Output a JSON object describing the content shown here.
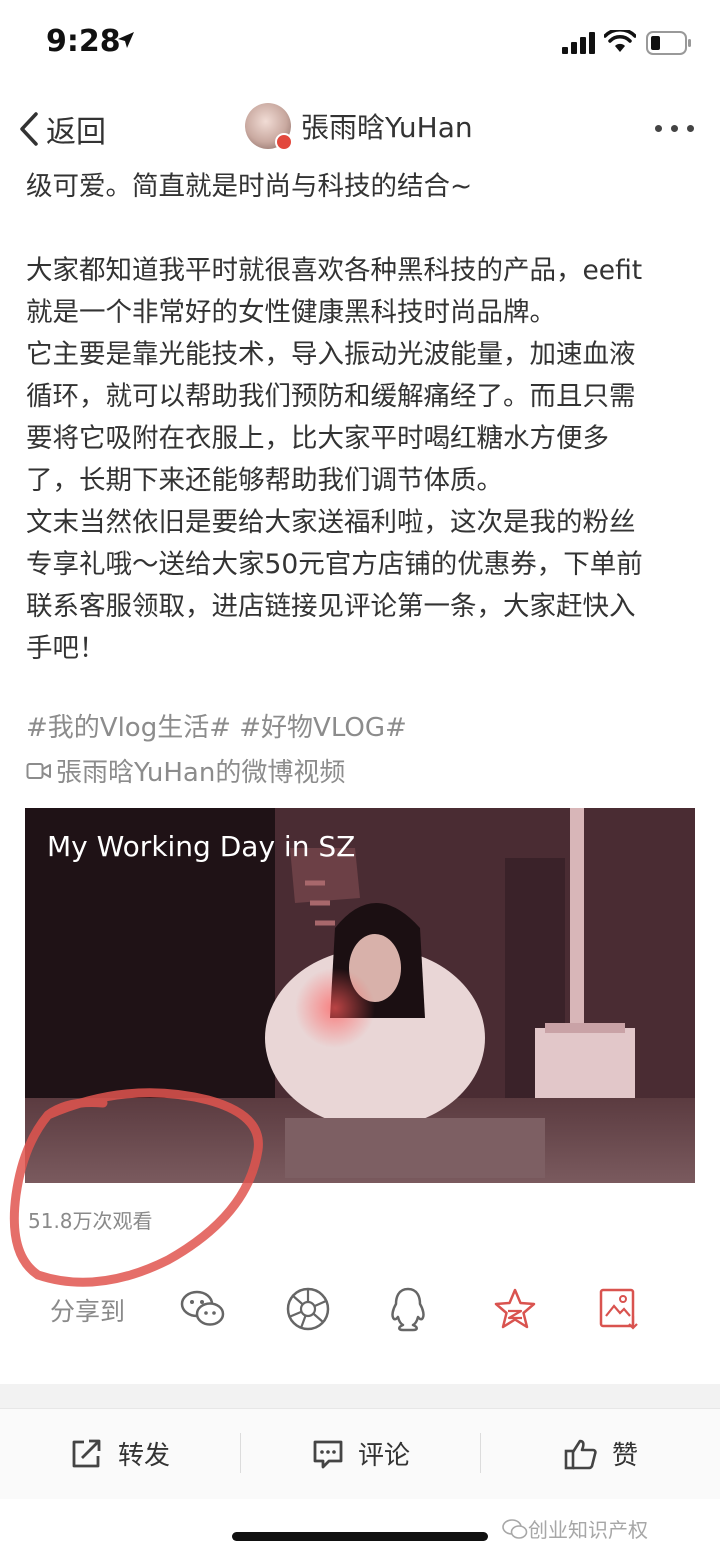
{
  "status": {
    "time": "9:28"
  },
  "nav": {
    "back_label": "返回",
    "username": "張雨晗YuHan"
  },
  "post": {
    "lines": [
      "级可爱。简直就是时尚与科技的结合~",
      "",
      "大家都知道我平时就很喜欢各种黑科技的产品，eefit",
      "就是一个非常好的女性健康黑科技时尚品牌。",
      "它主要是靠光能技术，导入振动光波能量，加速血液",
      "循环，就可以帮助我们预防和缓解痛经了。而且只需",
      "要将它吸附在衣服上，比大家平时喝红糖水方便多",
      "了，长期下来还能够帮助我们调节体质。",
      "文末当然依旧是要给大家送福利啦，这次是我的粉丝",
      "专享礼哦～送给大家50元官方店铺的优惠券，下单前",
      "联系客服领取，进店链接见评论第一条，大家赶快入",
      "手吧！"
    ],
    "tags": "#我的Vlog生活# #好物VLOG#",
    "video_link": "張雨晗YuHan的微博视频"
  },
  "video": {
    "title": "My Working Day in SZ",
    "views": "51.8万次观看"
  },
  "share": {
    "label": "分享到",
    "targets": [
      "wechat-icon",
      "moments-icon",
      "qq-icon",
      "qzone-icon",
      "save-image-icon"
    ]
  },
  "actions": {
    "repost": "转发",
    "comment": "评论",
    "like": "赞"
  },
  "watermark": "创业知识产权"
}
